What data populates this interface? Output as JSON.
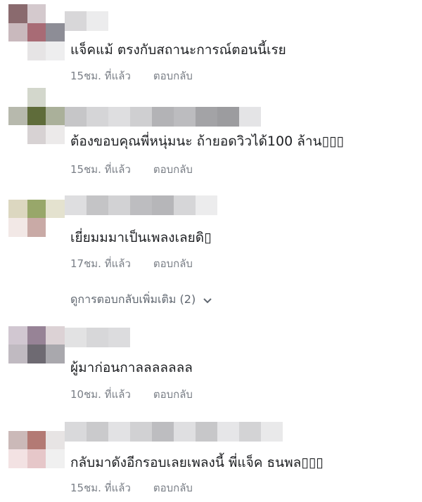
{
  "comments": [
    {
      "text": "แจ็คแม้ ตรงกับสถานะการณ์ตอนนี้เรย",
      "time": "15ชม. ที่แล้ว",
      "reply": "ตอบกลับ",
      "avatar_colors": [
        "#8a6a6e",
        "#d4c9cd",
        "#ffffff",
        "#c9b9bd",
        "#a86b75",
        "#8d8d96",
        "#ffffff",
        "#e6e4e5",
        "#eeeeef"
      ],
      "name_blur_colors": [
        "#d8d7d9",
        "#ececed"
      ]
    },
    {
      "text": "ต้องขอบคุณพี่หนุ่มนะ ถ้ายอดวิวได้100 ล้าน▯▯▯",
      "time": "15ชม. ที่แล้ว",
      "reply": "ตอบกลับ",
      "avatar_colors": [
        "#ffffff",
        "#d3d7cc",
        "#ffffff",
        "#b7b9ad",
        "#5f6c3a",
        "#aab09a",
        "#ffffff",
        "#d7d2d3",
        "#eceaea"
      ],
      "name_blur_colors": [
        "#c6c6c8",
        "#d5d5d7",
        "#dedee0",
        "#cfcfd1",
        "#b3b3b6",
        "#bcbcbf",
        "#a3a3a6",
        "#9c9c9f",
        "#e4e4e6"
      ]
    },
    {
      "text": "เยี่ยมมมาเป็นเพลงเลยดิ▯",
      "time": "17ชม. ที่แล้ว",
      "reply": "ตอบกลับ",
      "avatar_colors": [
        "#ffffff",
        "#ffffff",
        "#ffffff",
        "#dcd7c0",
        "#98a76a",
        "#e4e2cf",
        "#f2e8e6",
        "#c9aaa6",
        "#ffffff"
      ],
      "name_blur_colors": [
        "#dedee0",
        "#c4c4c6",
        "#d2d2d4",
        "#bdbdc0",
        "#b6b6b9",
        "#d6d6d8",
        "#ececed"
      ]
    },
    {
      "text": "ผู้มาก่อนกาลลลลลลล",
      "time": "10ชม. ที่แล้ว",
      "reply": "ตอบกลับ",
      "avatar_colors": [
        "#ffffff",
        "#ffffff",
        "#ffffff",
        "#d1c7d1",
        "#978396",
        "#dcd2d5",
        "#c0bac1",
        "#6e6a72",
        "#a9a8ad"
      ],
      "name_blur_colors": [
        "#e2e2e3",
        "#d7d7d9",
        "#dcdcde"
      ]
    },
    {
      "text": "กลับมาดังอีกรอบเลยเพลงนี้ พี่แจ็ค ธนพล▯▯▯",
      "time": "15ชม. ที่แล้ว",
      "reply": "ตอบกลับ",
      "avatar_colors": [
        "#ffffff",
        "#ffffff",
        "#ffffff",
        "#cbb9b8",
        "#b37a74",
        "#e7e4e4",
        "#f3e2e3",
        "#e6c7c9",
        "#f0f0f0"
      ],
      "name_blur_colors": [
        "#d9d9db",
        "#cacacc",
        "#e2e2e4",
        "#d1d1d3",
        "#bdbdc0",
        "#dfdfe1",
        "#c7c7c9",
        "#e6e6e8",
        "#d3d3d5",
        "#e9e9ea"
      ]
    }
  ],
  "more_replies": {
    "label": "ดูการตอบกลับเพิ่มเติม (2)",
    "icon": "chevron-down-icon"
  }
}
